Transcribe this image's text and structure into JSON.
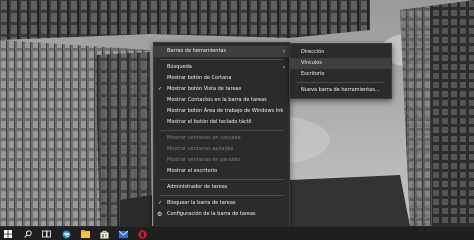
{
  "context_menu": {
    "items": [
      {
        "label": "Barras de herramientas",
        "submenu": true,
        "highlighted": true
      },
      {
        "separator": true
      },
      {
        "label": "Búsqueda",
        "submenu": true
      },
      {
        "label": "Mostrar botón de Cortana"
      },
      {
        "label": "Mostrar botón Vista de tareas",
        "checked": true
      },
      {
        "label": "Mostrar Contactos en la barra de tareas"
      },
      {
        "label": "Mostrar botón Área de trabajo de Windows Ink"
      },
      {
        "label": "Mostrar el botón del teclado táctil"
      },
      {
        "separator": true
      },
      {
        "label": "Mostrar ventanas en cascada",
        "disabled": true
      },
      {
        "label": "Mostrar ventanas apiladas",
        "disabled": true
      },
      {
        "label": "Mostrar ventanas en paralelo",
        "disabled": true
      },
      {
        "label": "Mostrar el escritorio"
      },
      {
        "separator": true
      },
      {
        "label": "Administrador de tareas"
      },
      {
        "separator": true
      },
      {
        "label": "Bloquear la barra de tareas",
        "checked": true
      },
      {
        "label": "Configuración de la barra de tareas",
        "gear": true
      }
    ]
  },
  "submenu": {
    "items": [
      {
        "label": "Dirección"
      },
      {
        "label": "Vínculos",
        "highlighted": true
      },
      {
        "label": "Escritorio"
      },
      {
        "separator": true
      },
      {
        "label": "Nueva barra de herramientas..."
      }
    ]
  },
  "taskbar": {
    "icons": [
      "windows-start-icon",
      "search-icon",
      "task-view-icon",
      "edge-icon",
      "file-explorer-icon",
      "store-icon",
      "mail-icon",
      "opera-icon"
    ]
  },
  "colors": {
    "menu_bg": "#2b2b2b",
    "menu_hover": "#3f3f3f",
    "taskbar_bg": "#1f1f1f",
    "disabled_text": "#7d7d7d"
  }
}
